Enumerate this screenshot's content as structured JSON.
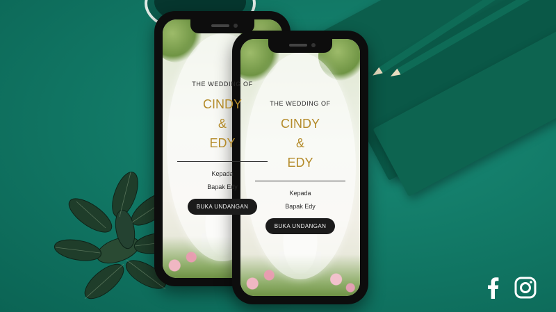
{
  "invitation": {
    "heading": "THE WEDDING OF",
    "bride": "CINDY",
    "ampersand": "&",
    "groom": "EDY",
    "recipient_label": "Kepada",
    "recipient_name": "Bapak Edy",
    "open_button_label": "BUKA UNDANGAN"
  },
  "social": {
    "icons": [
      "facebook-icon",
      "instagram-icon"
    ]
  },
  "colors": {
    "background": "#0f7664",
    "name_gold": "#b48b2a",
    "button": "#1b1b1b"
  }
}
